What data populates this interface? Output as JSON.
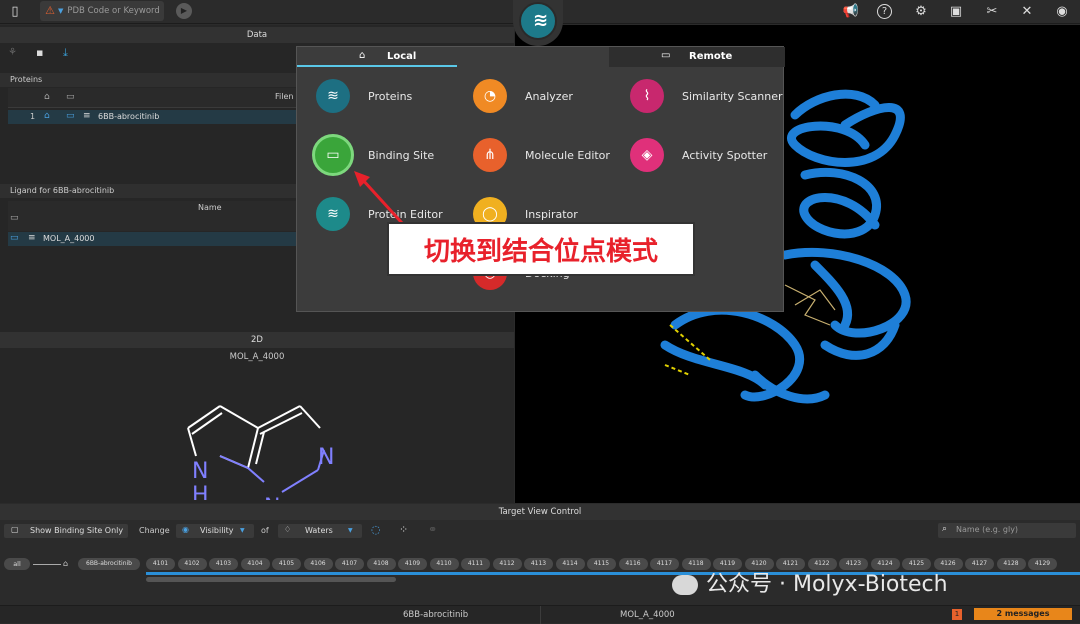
{
  "topbar": {
    "search_placeholder": "PDB Code or Keyword"
  },
  "data_panel": {
    "title": "Data"
  },
  "proteins": {
    "title": "Proteins",
    "column": "Filen",
    "rows": [
      {
        "index": "1",
        "name": "6BB-abrocitinib"
      }
    ]
  },
  "ligands": {
    "title": "Ligand for 6BB-abrocitinib",
    "column": "Name",
    "rows": [
      {
        "name": "MOL_A_4000"
      }
    ]
  },
  "twod": {
    "title": "2D",
    "molecule": "MOL_A_4000",
    "atoms": [
      "N",
      "H",
      "N",
      "N"
    ]
  },
  "menu": {
    "tabs": [
      "Local",
      "Remote"
    ],
    "items": [
      {
        "label": "Proteins",
        "color": "#1d6f82"
      },
      {
        "label": "Analyzer",
        "color": "#f08a24"
      },
      {
        "label": "Similarity Scanner",
        "color": "#c8286e"
      },
      {
        "label": "Binding Site",
        "color": "#3aa53a"
      },
      {
        "label": "Molecule Editor",
        "color": "#e8612c"
      },
      {
        "label": "Activity Spotter",
        "color": "#e0307a"
      },
      {
        "label": "Protein Editor",
        "color": "#1d8a8a"
      },
      {
        "label": "Inspirator",
        "color": "#f0b020"
      },
      {
        "label": "Docking",
        "color": "#d52a2a"
      }
    ]
  },
  "callout": {
    "text": "切换到结合位点模式"
  },
  "target_view": {
    "title": "Target View Control",
    "show_binding_only": "Show Binding Site Only",
    "change_label": "Change",
    "visibility_label": "Visibility",
    "of_label": "of",
    "waters_label": "Waters",
    "name_placeholder": "Name (e.g. gly)",
    "all_label": "all",
    "chain_label": "6BB-abrocitinib",
    "residues": [
      "4101",
      "4102",
      "4103",
      "4104",
      "4105",
      "4106",
      "4107",
      "4108",
      "4109",
      "4110",
      "4111",
      "4112",
      "4113",
      "4114",
      "4115",
      "4116",
      "4117",
      "4118",
      "4119",
      "4120",
      "4121",
      "4122",
      "4123",
      "4124",
      "4125",
      "4126",
      "4127",
      "4128",
      "4129"
    ]
  },
  "statusbar": {
    "protein": "6BB-abrocitinib",
    "ligand": "MOL_A_4000",
    "messages": "2 messages",
    "badge": "1"
  },
  "watermark": {
    "text": "公众号 · Molyx-Biotech"
  },
  "colors": {
    "accent": "#4aa0e0",
    "protein_ribbon": "#1e7fd8",
    "callout_text": "#e8212b",
    "messages": "#e8861a"
  }
}
